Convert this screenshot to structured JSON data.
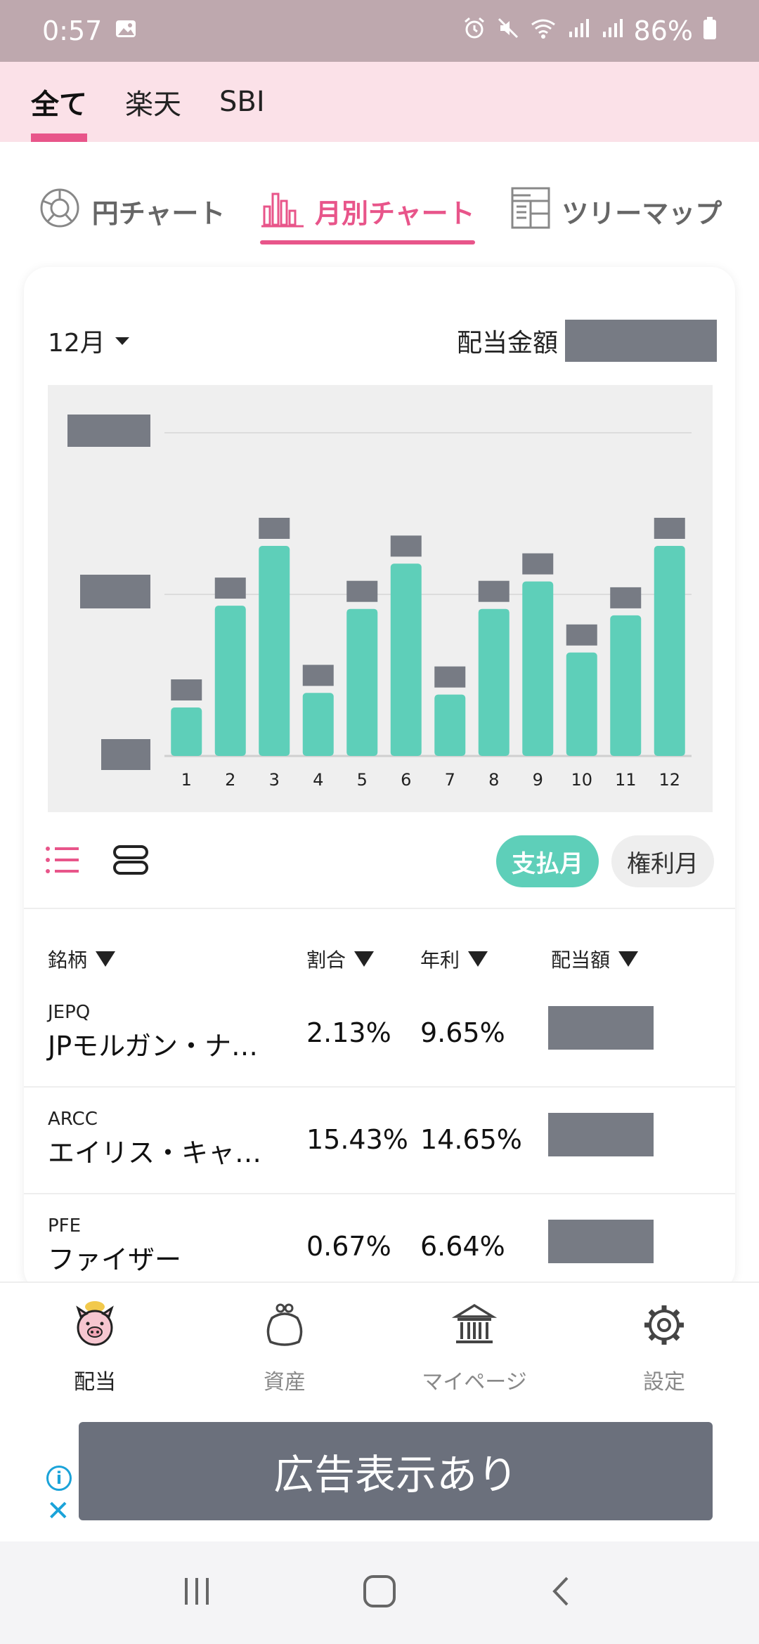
{
  "status_bar": {
    "time": "0:57",
    "battery": "86%"
  },
  "broker_tabs": [
    {
      "label": "全て",
      "active": true
    },
    {
      "label": "楽天",
      "active": false
    },
    {
      "label": "SBI",
      "active": false
    }
  ],
  "chart_tabs": [
    {
      "label": "円チャート",
      "icon": "pie-chart-icon",
      "active": false
    },
    {
      "label": "月別チャート",
      "icon": "bar-chart-icon",
      "active": true
    },
    {
      "label": "ツリーマップ",
      "icon": "treemap-icon",
      "active": false
    }
  ],
  "card": {
    "month_selector": "12月",
    "amount_label": "配当金額"
  },
  "chart_data": {
    "type": "bar",
    "categories": [
      "1",
      "2",
      "3",
      "4",
      "5",
      "6",
      "7",
      "8",
      "9",
      "10",
      "11",
      "12"
    ],
    "values": [
      0.3,
      0.93,
      1.3,
      0.39,
      0.91,
      1.19,
      0.38,
      0.91,
      1.08,
      0.64,
      0.87,
      1.3
    ],
    "ylim": [
      0,
      2
    ],
    "bar_color": "#5ecfb9",
    "grid": true,
    "notes_on_values": "y-axis labels and value labels are redacted; values are relative heights in gridline units"
  },
  "view_toggle": {
    "pills": [
      {
        "label": "支払月",
        "active": true
      },
      {
        "label": "権利月",
        "active": false
      }
    ]
  },
  "table": {
    "headers": {
      "stock": "銘柄",
      "ratio": "割合",
      "yield": "年利",
      "dividend": "配当額"
    },
    "rows": [
      {
        "ticker": "JEPQ",
        "name": "JPモルガン・ナ…",
        "ratio": "2.13%",
        "yield": "9.65%"
      },
      {
        "ticker": "ARCC",
        "name": "エイリス・キャ…",
        "ratio": "15.43%",
        "yield": "14.65%"
      },
      {
        "ticker": "PFE",
        "name": "ファイザー",
        "ratio": "0.67%",
        "yield": "6.64%"
      }
    ]
  },
  "bottom_nav": [
    {
      "label": "配当",
      "icon": "pig-icon",
      "active": true
    },
    {
      "label": "資産",
      "icon": "purse-icon",
      "active": false
    },
    {
      "label": "マイページ",
      "icon": "bank-icon",
      "active": false
    },
    {
      "label": "設定",
      "icon": "gear-icon",
      "active": false
    }
  ],
  "ad": {
    "text": "広告表示あり"
  },
  "colors": {
    "accent_pink": "#e8558a",
    "accent_teal": "#5ecfb9",
    "status_bar": "#bea8ae"
  }
}
